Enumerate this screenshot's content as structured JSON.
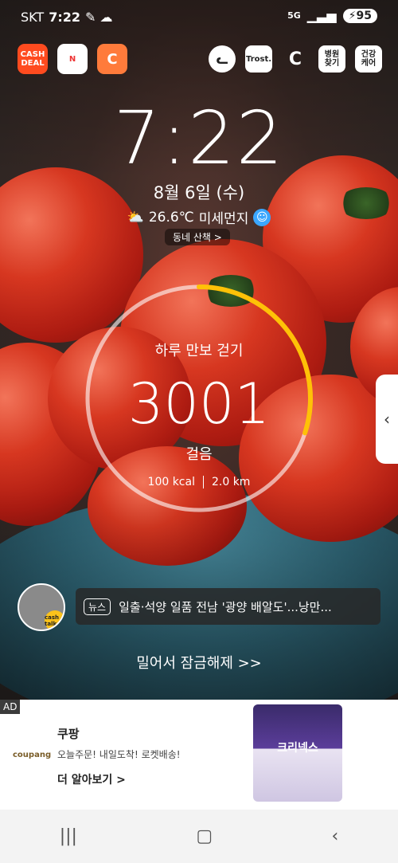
{
  "status_bar": {
    "carrier": "SKT",
    "time": "7:22",
    "network": "5G",
    "battery": "95"
  },
  "top_apps": [
    {
      "label": "CASH DEAL",
      "color": "#ff4b1f"
    },
    {
      "label": "N",
      "color": "#ffffff"
    },
    {
      "label": "C",
      "color": "#ff7b3b"
    }
  ],
  "top_right_icons": [
    {
      "label": "",
      "name": "cat-icon"
    },
    {
      "label": "Trost.",
      "name": "trost-icon"
    },
    {
      "label": "C",
      "name": "cashwalk-icon"
    },
    {
      "label": "병원\n찾기",
      "name": "hospital-search-icon"
    },
    {
      "label": "건강\n케어",
      "name": "health-care-icon"
    }
  ],
  "lockscreen": {
    "clock": "7:22",
    "date": "8월 6일 (수)",
    "temperature": "26.6℃",
    "dust_label": "미세먼지",
    "walk_button": "동네 산책 >"
  },
  "step_widget": {
    "title": "하루 만보 걷기",
    "steps": "3001",
    "unit": "걸음",
    "kcal": "100 kcal",
    "distance": "2.0 km",
    "progress_fraction": 0.3
  },
  "cashtalk": {
    "badge": "cash talk"
  },
  "news": {
    "tag": "뉴스",
    "headline": "일출·석양 일품 전남 '광양 배알도'...낭만..."
  },
  "unlock_hint": "밀어서 잠금해제 >>",
  "ad": {
    "label": "AD",
    "brand": "coupang",
    "title": "쿠팡",
    "description": "오늘주문! 내일도착! 로켓배송!",
    "cta": "더 알아보기 >",
    "product_name": "크리넥스"
  },
  "colors": {
    "progress_ring": "#ffc107",
    "ring_track": "rgba(255,255,255,0.6)"
  }
}
